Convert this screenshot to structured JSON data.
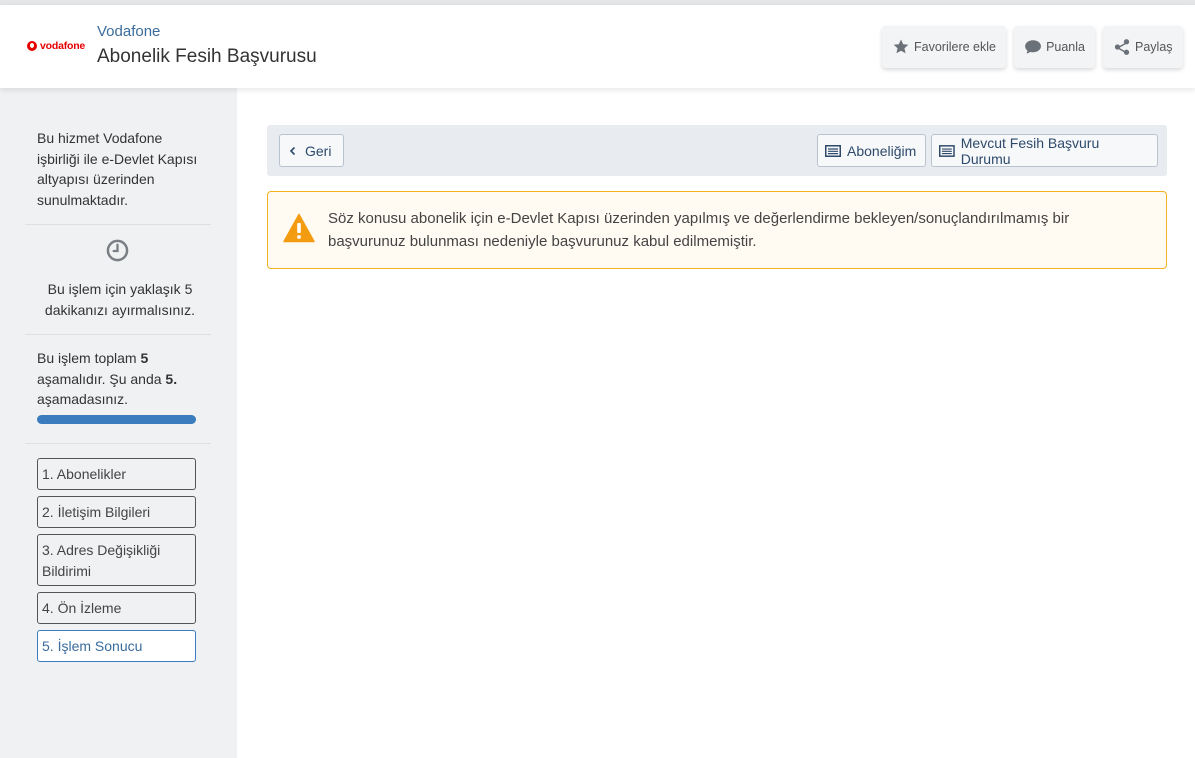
{
  "header": {
    "logo_text": "vodafone",
    "brand": "Vodafone",
    "title": "Abonelik Fesih Başvurusu",
    "buttons": {
      "favorite": "Favorilere ekle",
      "rate": "Puanla",
      "share": "Paylaş"
    },
    "icons": [
      "star-icon",
      "chat-bubble-icon",
      "share-icon"
    ]
  },
  "sidebar": {
    "info": "Bu hizmet Vodafone işbirliği ile e-Devlet Kapısı altyapısı üzerinden sunulmaktadır.",
    "time_icon": "clock-icon",
    "time_text": "Bu işlem için yaklaşık 5 dakikanızı ayırmalısınız.",
    "stage": {
      "prefix": "Bu işlem toplam ",
      "total": "5",
      "middle": " aşamalıdır. Şu anda ",
      "current": "5.",
      "suffix": " aşamadasınız."
    },
    "progress_fraction": 1.0,
    "steps": [
      {
        "label": "1. Abonelikler"
      },
      {
        "label": "2. İletişim Bilgileri"
      },
      {
        "label": "3. Adres Değişikliği Bildirimi"
      },
      {
        "label": "4. Ön İzleme"
      },
      {
        "label": "5. İşlem Sonucu",
        "active": true
      }
    ]
  },
  "toolbar": {
    "back": "Geri",
    "subscription": "Aboneliğim",
    "status": "Mevcut Fesih Başvuru Durumu"
  },
  "alert": {
    "icon": "warning-icon",
    "message": "Söz konusu abonelik için e-Devlet Kapısı üzerinden yapılmış ve değerlendirme bekleyen/sonuçlandırılmamış bir başvurunuz bulunması nedeniyle başvurunuz kabul edilmemiştir.",
    "color": "#f3b223"
  },
  "colors": {
    "accent": "#3a7cbd",
    "brand_red": "#e60000",
    "sidebar_bg": "#f0f1f3"
  }
}
